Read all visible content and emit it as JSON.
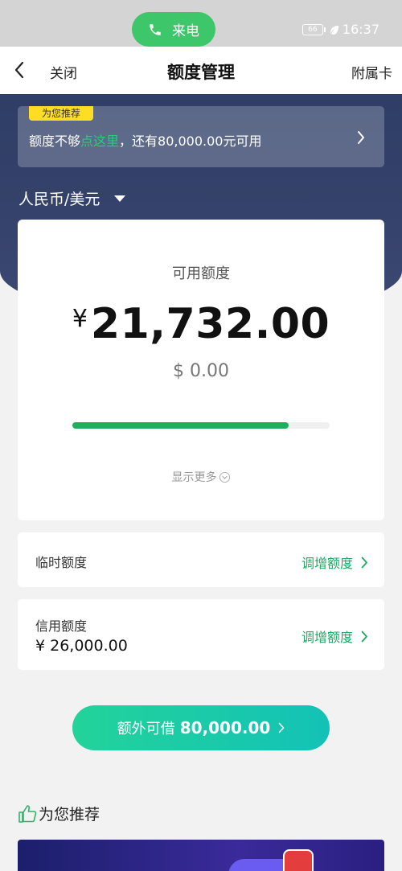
{
  "status_bar": {
    "call_label": "来电",
    "battery": "66",
    "time": "16:37"
  },
  "nav": {
    "close_label": "关闭",
    "title": "额度管理",
    "right_link": "附属卡"
  },
  "promo": {
    "tag": "为您推荐",
    "text_before": "额度不够",
    "text_highlight": "点这里",
    "text_after": "，还有80,000.00元可用"
  },
  "currency": {
    "selected": "人民币/美元"
  },
  "limit_card": {
    "label": "可用额度",
    "currency_symbol": "¥",
    "amount": "21,732.00",
    "usd_amount": "$ 0.00",
    "used_fraction": 0.84,
    "show_more": "显示更多"
  },
  "temp_limit": {
    "label": "临时额度",
    "action": "调增额度"
  },
  "credit_limit": {
    "label": "信用额度",
    "value": "¥ 26,000.00",
    "action": "调增额度"
  },
  "borrow": {
    "label": "额外可借",
    "amount": "80,000.00"
  },
  "recommend": {
    "title": "为您推荐"
  },
  "colors": {
    "accent_green": "#21a862",
    "header_navy": "#36436c",
    "promo_tag": "#ffdd22"
  }
}
